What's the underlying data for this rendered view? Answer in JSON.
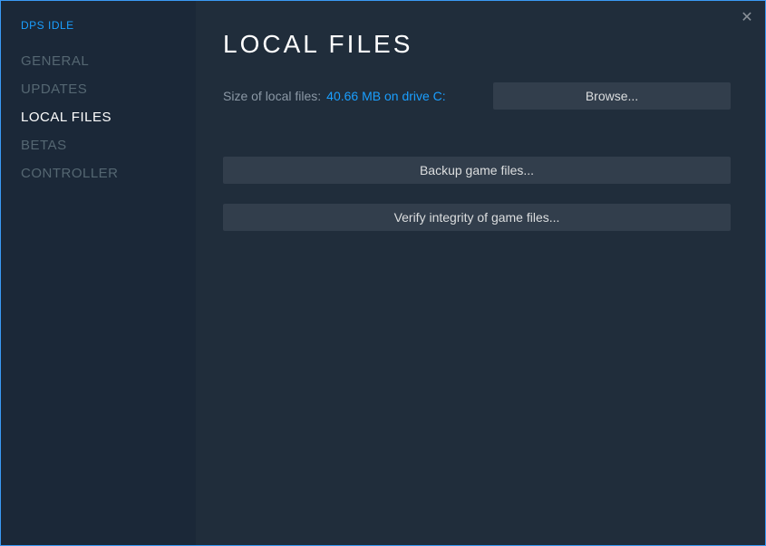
{
  "sidebar": {
    "title": "DPS IDLE",
    "items": [
      {
        "label": "GENERAL"
      },
      {
        "label": "UPDATES"
      },
      {
        "label": "LOCAL FILES"
      },
      {
        "label": "BETAS"
      },
      {
        "label": "CONTROLLER"
      }
    ]
  },
  "main": {
    "title": "LOCAL FILES",
    "size_label": "Size of local files:",
    "size_value": "40.66 MB on drive C:",
    "browse_label": "Browse...",
    "backup_label": "Backup game files...",
    "verify_label": "Verify integrity of game files..."
  }
}
